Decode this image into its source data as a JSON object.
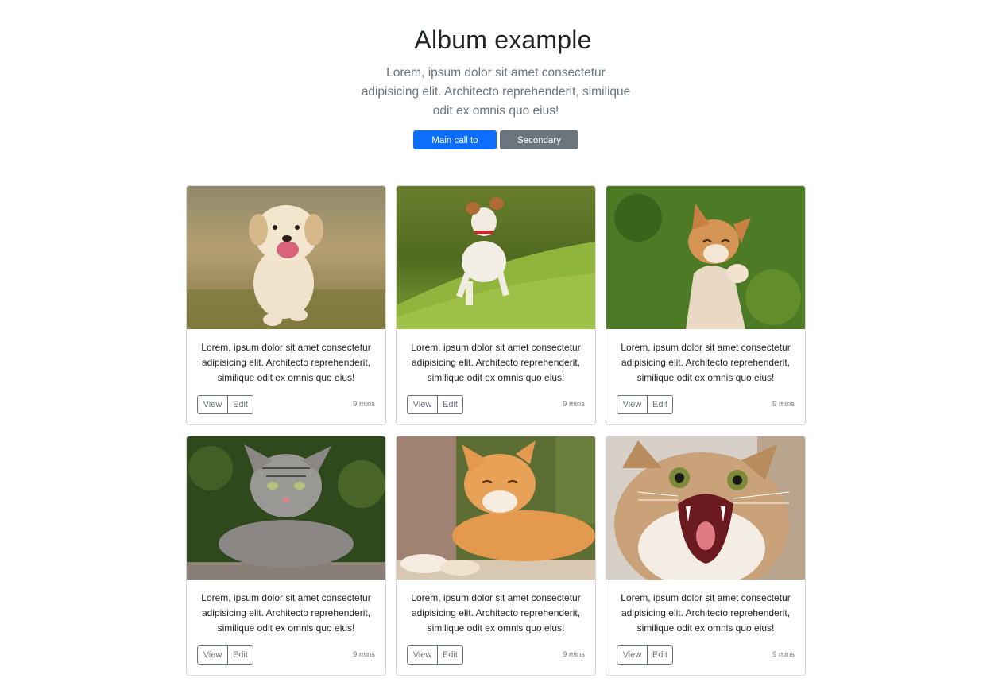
{
  "hero": {
    "title": "Album example",
    "lead": "Lorem, ipsum dolor sit amet consectetur adipisicing elit. Architecto reprehenderit, similique odit ex omnis quo eius!",
    "primary_label": "Main call to action",
    "secondary_label": "Secondary action"
  },
  "colors": {
    "primary": "#0d6efd",
    "secondary": "#6c757d"
  },
  "cards": [
    {
      "image": "golden-retriever-puppy",
      "text": "Lorem, ipsum dolor sit amet consectetur adipisicing elit. Architecto reprehenderit, similique odit ex omnis quo eius!",
      "view_label": "View",
      "edit_label": "Edit",
      "time": "9 mins"
    },
    {
      "image": "jack-russell-jumping",
      "text": "Lorem, ipsum dolor sit amet consectetur adipisicing elit. Architecto reprehenderit, similique odit ex omnis quo eius!",
      "view_label": "View",
      "edit_label": "Edit",
      "time": "9 mins"
    },
    {
      "image": "corgi-on-moss",
      "text": "Lorem, ipsum dolor sit amet consectetur adipisicing elit. Architecto reprehenderit, similique odit ex omnis quo eius!",
      "view_label": "View",
      "edit_label": "Edit",
      "time": "9 mins"
    },
    {
      "image": "tabby-cat",
      "text": "Lorem, ipsum dolor sit amet consectetur adipisicing elit. Architecto reprehenderit, similique odit ex omnis quo eius!",
      "view_label": "View",
      "edit_label": "Edit",
      "time": "9 mins"
    },
    {
      "image": "orange-cat-lounging",
      "text": "Lorem, ipsum dolor sit amet consectetur adipisicing elit. Architecto reprehenderit, similique odit ex omnis quo eius!",
      "view_label": "View",
      "edit_label": "Edit",
      "time": "9 mins"
    },
    {
      "image": "hissing-cat",
      "text": "Lorem, ipsum dolor sit amet consectetur adipisicing elit. Architecto reprehenderit, similique odit ex omnis quo eius!",
      "view_label": "View",
      "edit_label": "Edit",
      "time": "9 mins"
    }
  ]
}
